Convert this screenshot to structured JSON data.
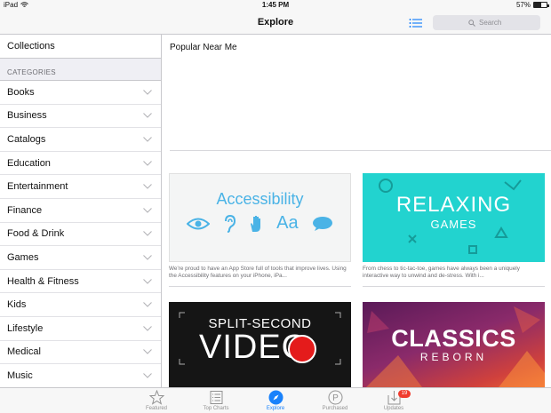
{
  "status_bar": {
    "device": "iPad",
    "time": "1:45 PM",
    "battery": "57%",
    "battery_level": 0.57
  },
  "nav": {
    "title": "Explore",
    "search_placeholder": "Search"
  },
  "sidebar": {
    "collections": "Collections",
    "categories_header": "CATEGORIES",
    "categories": [
      "Books",
      "Business",
      "Catalogs",
      "Education",
      "Entertainment",
      "Finance",
      "Food & Drink",
      "Games",
      "Health & Fitness",
      "Kids",
      "Lifestyle",
      "Medical",
      "Music"
    ]
  },
  "content": {
    "popular_title": "Popular Near Me",
    "cards": [
      {
        "title": "Accessibility",
        "desc": "We're proud to have an App Store full of tools that improve lives. Using the Accessibility features on your iPhone, iPa..."
      },
      {
        "title": "RELAXING",
        "subtitle": "GAMES",
        "desc": "From chess to tic-tac-toe, games have always been a uniquely interactive way to unwind and de-stress. With i..."
      },
      {
        "title": "SPLIT-SECOND",
        "subtitle": "VIDEO"
      },
      {
        "title": "CLASSICS",
        "subtitle": "REBORN"
      }
    ]
  },
  "tabbar": {
    "tabs": [
      {
        "label": "Featured",
        "icon": "star-icon"
      },
      {
        "label": "Top Charts",
        "icon": "list-icon"
      },
      {
        "label": "Explore",
        "icon": "compass-icon"
      },
      {
        "label": "Purchased",
        "icon": "purchased-icon"
      },
      {
        "label": "Updates",
        "icon": "download-icon",
        "badge": "19"
      }
    ],
    "active_color": "#1a82fb"
  }
}
